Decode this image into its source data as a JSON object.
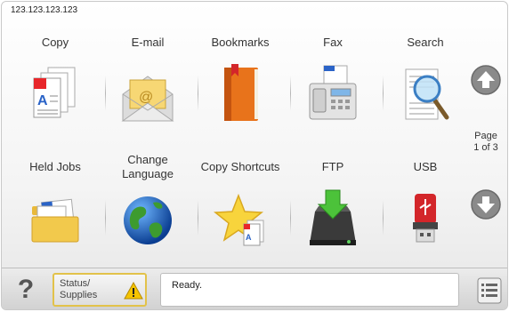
{
  "header": {
    "ip_address": "123.123.123.123"
  },
  "apps": [
    {
      "label": "Copy",
      "icon": "copy-icon"
    },
    {
      "label": "E-mail",
      "icon": "email-icon"
    },
    {
      "label": "Bookmarks",
      "icon": "bookmarks-icon"
    },
    {
      "label": "Fax",
      "icon": "fax-icon"
    },
    {
      "label": "Search",
      "icon": "search-icon"
    },
    {
      "label": "Held Jobs",
      "icon": "held-jobs-icon"
    },
    {
      "label": "Change Language",
      "icon": "globe-icon"
    },
    {
      "label": "Copy Shortcuts",
      "icon": "copy-shortcuts-icon"
    },
    {
      "label": "FTP",
      "icon": "ftp-icon"
    },
    {
      "label": "USB",
      "icon": "usb-icon"
    }
  ],
  "pager": {
    "page_label": "Page",
    "page_count_text": "1 of 3"
  },
  "bottom": {
    "help_glyph": "?",
    "status_label_line1": "Status/",
    "status_label_line2": "Supplies",
    "message": "Ready."
  },
  "colors": {
    "status_border": "#e2c24a",
    "warning_fill": "#f5c400",
    "nav_button": "#8a8a8a"
  }
}
